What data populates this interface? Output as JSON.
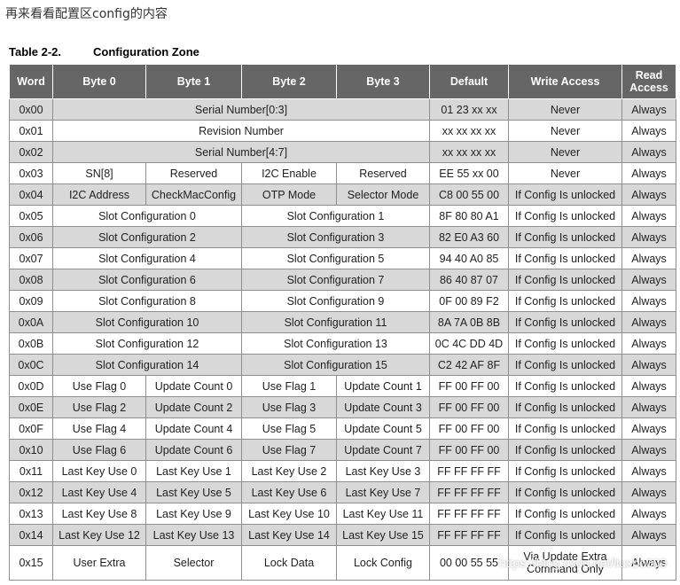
{
  "intro_text": "再来看看配置区config的内容",
  "caption": {
    "number": "Table 2-2.",
    "title": "Configuration Zone"
  },
  "headers": {
    "word": "Word",
    "byte0": "Byte 0",
    "byte1": "Byte 1",
    "byte2": "Byte 2",
    "byte3": "Byte 3",
    "default": "Default",
    "write_access": "Write Access",
    "read_access_line1": "Read",
    "read_access_line2": "Access"
  },
  "rows": [
    {
      "word": "0x00",
      "cells": [
        "Serial Number[0:3]"
      ],
      "default": "01 23 xx xx",
      "write": "Never",
      "read": "Always"
    },
    {
      "word": "0x01",
      "cells": [
        "Revision Number"
      ],
      "default": "xx xx xx xx",
      "write": "Never",
      "read": "Always"
    },
    {
      "word": "0x02",
      "cells": [
        "Serial Number[4:7]"
      ],
      "default": "xx xx xx xx",
      "write": "Never",
      "read": "Always"
    },
    {
      "word": "0x03",
      "cells": [
        "SN[8]",
        "Reserved",
        "I2C Enable",
        "Reserved"
      ],
      "default": "EE 55 xx 00",
      "write": "Never",
      "read": "Always"
    },
    {
      "word": "0x04",
      "cells": [
        "I2C Address",
        "CheckMacConfig",
        "OTP Mode",
        "Selector Mode"
      ],
      "default": "C8 00 55 00",
      "write": "If Config Is unlocked",
      "read": "Always"
    },
    {
      "word": "0x05",
      "cells": [
        "Slot Configuration 0",
        "Slot Configuration 1"
      ],
      "default": "8F 80 80 A1",
      "write": "If Config Is unlocked",
      "read": "Always"
    },
    {
      "word": "0x06",
      "cells": [
        "Slot Configuration 2",
        "Slot Configuration 3"
      ],
      "default": "82 E0 A3 60",
      "write": "If Config Is unlocked",
      "read": "Always"
    },
    {
      "word": "0x07",
      "cells": [
        "Slot Configuration 4",
        "Slot Configuration 5"
      ],
      "default": "94 40 A0 85",
      "write": "If Config Is unlocked",
      "read": "Always"
    },
    {
      "word": "0x08",
      "cells": [
        "Slot Configuration 6",
        "Slot Configuration 7"
      ],
      "default": "86 40 87 07",
      "write": "If Config Is unlocked",
      "read": "Always"
    },
    {
      "word": "0x09",
      "cells": [
        "Slot Configuration 8",
        "Slot Configuration 9"
      ],
      "default": "0F 00 89 F2",
      "write": "If Config Is unlocked",
      "read": "Always"
    },
    {
      "word": "0x0A",
      "cells": [
        "Slot Configuration 10",
        "Slot Configuration 11"
      ],
      "default": "8A 7A 0B 8B",
      "write": "If Config Is unlocked",
      "read": "Always"
    },
    {
      "word": "0x0B",
      "cells": [
        "Slot Configuration 12",
        "Slot Configuration 13"
      ],
      "default": "0C 4C DD 4D",
      "write": "If Config Is unlocked",
      "read": "Always"
    },
    {
      "word": "0x0C",
      "cells": [
        "Slot Configuration 14",
        "Slot Configuration 15"
      ],
      "default": "C2 42 AF 8F",
      "write": "If Config Is unlocked",
      "read": "Always"
    },
    {
      "word": "0x0D",
      "cells": [
        "Use Flag 0",
        "Update Count 0",
        "Use Flag 1",
        "Update Count 1"
      ],
      "default": "FF 00 FF 00",
      "write": "If Config Is unlocked",
      "read": "Always"
    },
    {
      "word": "0x0E",
      "cells": [
        "Use Flag 2",
        "Update Count 2",
        "Use Flag 3",
        "Update Count 3"
      ],
      "default": "FF 00 FF 00",
      "write": "If Config Is unlocked",
      "read": "Always"
    },
    {
      "word": "0x0F",
      "cells": [
        "Use Flag 4",
        "Update Count 4",
        "Use Flag 5",
        "Update Count 5"
      ],
      "default": "FF 00 FF 00",
      "write": "If Config Is unlocked",
      "read": "Always"
    },
    {
      "word": "0x10",
      "cells": [
        "Use Flag 6",
        "Update Count 6",
        "Use Flag 7",
        "Update Count 7"
      ],
      "default": "FF 00 FF 00",
      "write": "If Config Is unlocked",
      "read": "Always"
    },
    {
      "word": "0x11",
      "cells": [
        "Last Key Use 0",
        "Last Key Use 1",
        "Last Key Use 2",
        "Last Key Use 3"
      ],
      "default": "FF FF FF FF",
      "write": "If Config Is unlocked",
      "read": "Always"
    },
    {
      "word": "0x12",
      "cells": [
        "Last Key Use 4",
        "Last Key Use 5",
        "Last Key Use 6",
        "Last Key Use 7"
      ],
      "default": "FF FF FF FF",
      "write": "If Config Is unlocked",
      "read": "Always"
    },
    {
      "word": "0x13",
      "cells": [
        "Last Key Use 8",
        "Last Key Use 9",
        "Last Key Use 10",
        "Last Key Use 11"
      ],
      "default": "FF FF FF FF",
      "write": "If Config Is unlocked",
      "read": "Always"
    },
    {
      "word": "0x14",
      "cells": [
        "Last Key Use 12",
        "Last Key Use 13",
        "Last Key Use 14",
        "Last Key Use 15"
      ],
      "default": "FF FF FF FF",
      "write": "If Config Is unlocked",
      "read": "Always"
    },
    {
      "word": "0x15",
      "cells": [
        "User Extra",
        "Selector",
        "Lock Data",
        "Lock Config"
      ],
      "default": "00 00 55 55",
      "write": "Via Update Extra Command Only",
      "read": "Always"
    }
  ],
  "watermark": "https://blog.csdn.net/liuxbo000",
  "colors": {
    "header_bg": "#666666",
    "header_text": "#ffffff",
    "row_shaded": "#d8d8d8",
    "row_plain": "#ffffff",
    "grid_line": "#8f8f8f"
  }
}
